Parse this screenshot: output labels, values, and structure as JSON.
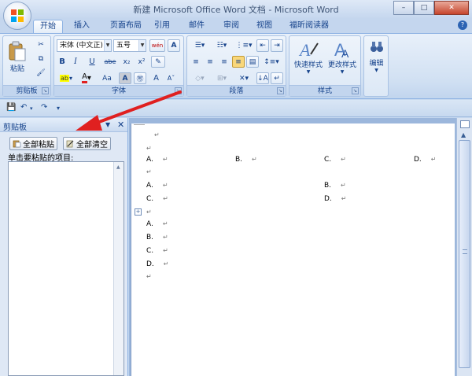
{
  "window": {
    "title": "新建 Microsoft Office Word 文档 - Microsoft Word",
    "minimize": "–",
    "maximize": "□",
    "close": "✕"
  },
  "tabs": [
    "开始",
    "插入",
    "页面布局",
    "引用",
    "邮件",
    "审阅",
    "视图",
    "福昕阅读器"
  ],
  "ribbon": {
    "clipboard": {
      "paste_label": "粘贴",
      "group_label": "剪贴板"
    },
    "font": {
      "font_name": "宋体 (中文正)",
      "font_size": "五号",
      "wen_label": "wén",
      "bold": "B",
      "italic": "I",
      "underline": "U",
      "strike": "abe",
      "subscript": "x₂",
      "superscript": "x²",
      "case": "Aa",
      "grow": "A",
      "group_label": "字体"
    },
    "paragraph": {
      "group_label": "段落"
    },
    "styles": {
      "quick_styles_label": "快速样式",
      "change_styles_label": "更改样式",
      "group_label": "样式"
    },
    "editing": {
      "label": "编辑"
    }
  },
  "qat": {
    "save": "💾",
    "undo": "↶",
    "redo": "↷",
    "more": "▾"
  },
  "clipboard_pane": {
    "title": "剪贴板",
    "paste_all": "全部粘贴",
    "clear_all": "全部清空",
    "hint": "单击要粘贴的项目:"
  },
  "document": {
    "mark": "↵",
    "row1": [
      "A.",
      "B.",
      "C.",
      "D."
    ],
    "row2": [
      "A.",
      "B."
    ],
    "row3": [
      "C.",
      "D."
    ],
    "list": [
      "A.",
      "B.",
      "C.",
      "D."
    ]
  },
  "colors": {
    "annotation_arrow": "#e02020",
    "ribbon_text": "#15428b"
  }
}
